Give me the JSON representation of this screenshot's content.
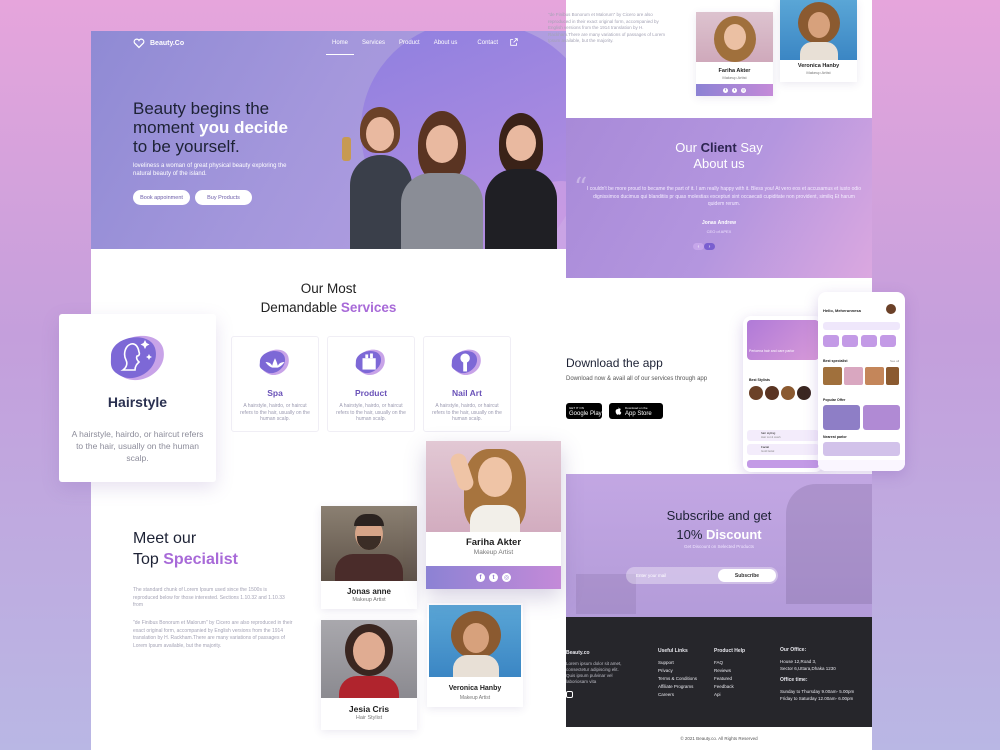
{
  "brand": {
    "name": "Beauty.Co"
  },
  "nav": {
    "home": "Home",
    "services": "Services",
    "product": "Product",
    "about": "About us",
    "contact": "Contact"
  },
  "hero": {
    "title_1": "Beauty begins the",
    "title_2a": "moment ",
    "title_2b": "you decide",
    "title_3": "to be yourself.",
    "subtitle": "loveliness a woman of great physical beauty exploring the natural beauty of the island.",
    "book_button": "Book appoinment",
    "buy_button": "Buy Products"
  },
  "services": {
    "title_1": "Our Most",
    "title_2a": "Demandable ",
    "title_2b": "Services",
    "items": [
      {
        "name": "Spa",
        "desc": "A hairstyle, hairdo, or haircut refers to the hair, usually on the human scalp."
      },
      {
        "name": "Product",
        "desc": "A hairstyle, hairdo, or haircut refers to the hair, usually on the human scalp."
      },
      {
        "name": "Nail Art",
        "desc": "A hairstyle, hairdo, or haircut refers to the hair, usually on the human scalp."
      }
    ],
    "featured": {
      "name": "Hairstyle",
      "desc": "A hairstyle, hairdo, or haircut refers to the hair, usually on the human scalp."
    }
  },
  "specialist": {
    "title_1": "Meet our",
    "title_2a": "Top ",
    "title_2b": "Specialist",
    "para_1": "The standard chunk of Lorem Ipsum used since the 1500s is reproduced below for those interested. Sections 1.10.32 and 1.10.33 from",
    "para_2": "\"de Finibus Bonorum et Malorum\" by Cicero are also reproduced in their exact original form, accompanied by English versions from the 1914 translation by H. Rackham.There are many variations of passages of Lorem Ipsum available, but the majority.",
    "people": [
      {
        "name": "Jonas anne",
        "role": "Makeup Artist"
      },
      {
        "name": "Jesia Cris",
        "role": "Hair Stylist"
      },
      {
        "name": "Fariha Akter",
        "role": "Makeup Artist"
      },
      {
        "name": "Veronica Hanby",
        "role": "Makeup Artist"
      }
    ]
  },
  "right": {
    "top_text": "\"de Finibus Bonorum et Malorum\" by Cicero are also reproduced in their exact original form, accompanied by English versions from the 1914 translation by H. Rackham.There are many variations of passages of Lorem Ipsum available, but the majority.",
    "client": {
      "title_a": "Our ",
      "title_b": "Client",
      "title_c": " Say",
      "title_2": "About us",
      "quote": "I couldn't be more proud to became the part of it. I am really happy with it. Bless you! At vero eos et accusamus et iusto odio dignissimos ducimus qui blanditiis pr quas molestias excepturi sint occaecati cupiditate non provident, similiq Et harum quidem rerum.",
      "name": "Jonas Andrew",
      "role": "CEO of APEX"
    },
    "download": {
      "title": "Download the app",
      "subtitle": "Download now & avail all of our services through app",
      "google_small": "GET IT ON",
      "google": "Google Play",
      "apple_small": "Download on the",
      "apple": "App Store"
    },
    "phone": {
      "greeting": "Hello, Meherunnesa",
      "banner": "Perioena hair and care parlor",
      "best_stylists": "Best Stylists",
      "best_specialist": "Best specialist",
      "popular_offer": "Popular Offer",
      "nearest_parlor": "Nearest parlor",
      "see_all": "See all",
      "list": [
        {
          "title": "hair styling",
          "sub": "Hair cut & wash"
        },
        {
          "title": "Facial",
          "sub": "Gold facial"
        }
      ]
    },
    "subscribe": {
      "title_1": "Subscribe and get",
      "title_2a": "10% ",
      "title_2b": "Discount",
      "small": "Get Discount on Selected Products",
      "placeholder": "Enter your mail",
      "button": "Subscribe"
    },
    "footer": {
      "brand": "Beauty.co",
      "brand_text": "Lorem ipsum dolor sit amet, consectetur adipiscing elit. Quis ipsum pulvinar vel laboriosam vita",
      "useful_title": "Useful Links",
      "useful": [
        "Support",
        "Privacy",
        "Terms & Conditions",
        "Affiliate Programs",
        "Careers"
      ],
      "help_title": "Product Help",
      "help": [
        "FAQ",
        "Reviews",
        "Featured",
        "Feedback",
        "Api"
      ],
      "office_title": "Our Office:",
      "office_1": "House 12,Road 3,",
      "office_2": "Sector 6,Uttara,Dhaka 1230",
      "time_title": "Office time:",
      "time_1": "Sunday to Thursday 9.00am- 5.00pm",
      "time_2": "Friday to Saturday 12.00am- 6.00pm",
      "copyright": "© 2021 Beauty.co. All Rights Reserved"
    }
  },
  "colors": {
    "accent": "#a86ad8",
    "primary": "#6a52b8",
    "dark": "#1d2235"
  },
  "icons": [
    "heart-logo-icon",
    "external-link-icon",
    "spa-icon",
    "product-icon",
    "nail-art-icon",
    "hairstyle-icon",
    "facebook-icon",
    "twitter-icon",
    "instagram-icon"
  ]
}
